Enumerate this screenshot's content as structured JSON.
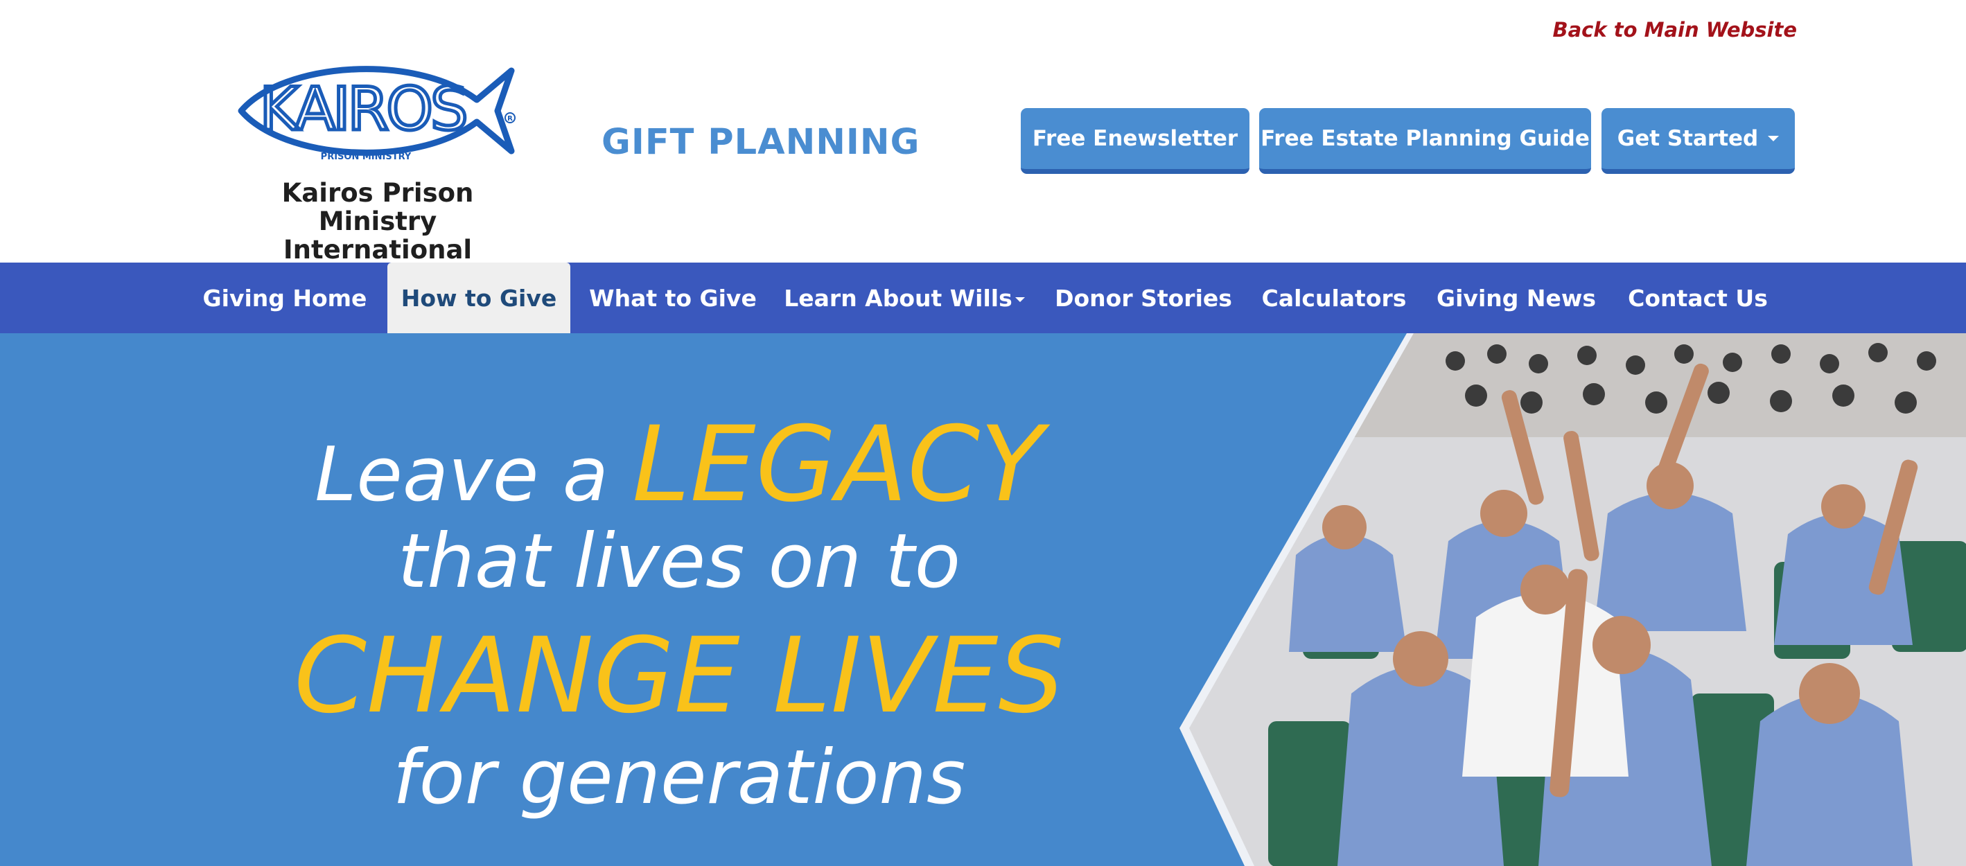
{
  "header": {
    "back_link": "Back to Main Website",
    "logo_word": "KAIROS",
    "logo_sub": "PRISON MINISTRY",
    "org_name_line1": "Kairos Prison Ministry",
    "org_name_line2": "International",
    "section_title": "GIFT PLANNING",
    "buttons": [
      {
        "label": "Free Enewsletter"
      },
      {
        "label": "Free Estate Planning Guide"
      },
      {
        "label": "Get Started"
      }
    ]
  },
  "nav": {
    "items": [
      {
        "label": "Giving Home",
        "active": false
      },
      {
        "label": "How to Give",
        "active": true
      },
      {
        "label": "What to Give",
        "active": false
      },
      {
        "label": "Learn About Wills",
        "active": false,
        "dropdown": true
      },
      {
        "label": "Donor Stories",
        "active": false
      },
      {
        "label": "Calculators",
        "active": false
      },
      {
        "label": "Giving News",
        "active": false
      },
      {
        "label": "Contact Us",
        "active": false
      }
    ]
  },
  "hero": {
    "line1_white": "Leave a",
    "line1_yellow": "LEGACY",
    "line2": "that lives on to",
    "line3": "CHANGE LIVES",
    "line4": "for generations",
    "photo_icon": "crowd-with-raised-hands-image"
  },
  "colors": {
    "brand_blue": "#4a8dd1",
    "nav_blue": "#3a58bd",
    "hero_blue": "#4588cc",
    "accent_yellow": "#f9c21a",
    "link_red": "#a3121a"
  }
}
